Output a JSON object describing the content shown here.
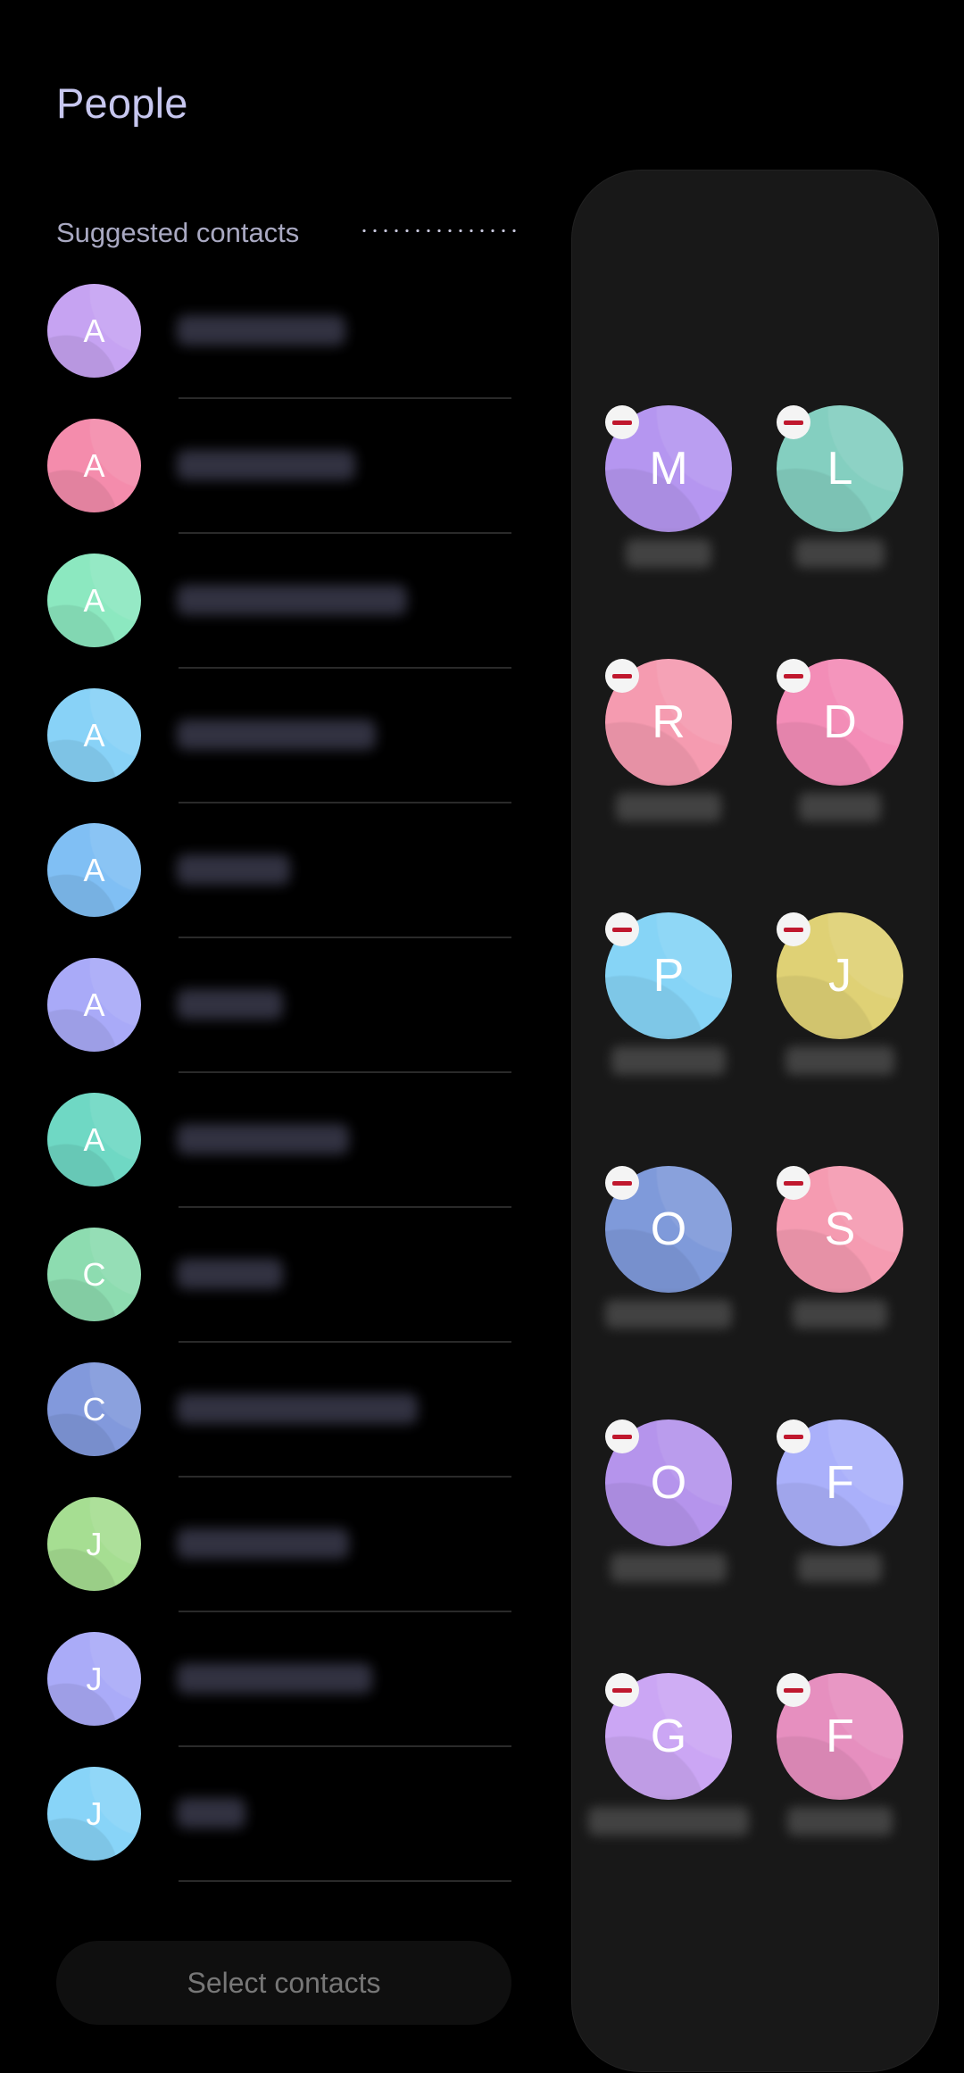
{
  "header": {
    "title": "People"
  },
  "suggested": {
    "section_label": "Suggested contacts",
    "contacts": [
      {
        "initial": "A",
        "color": "#c6a3f2",
        "name": "[blurred]",
        "blur_width": 0.49
      },
      {
        "initial": "A",
        "color": "#f48cac",
        "name": "[blurred]",
        "blur_width": 0.52
      },
      {
        "initial": "A",
        "color": "#8ce8c0",
        "name": "[blurred]",
        "blur_width": 0.67
      },
      {
        "initial": "A",
        "color": "#88d2f7",
        "name": "[blurred]",
        "blur_width": 0.58
      },
      {
        "initial": "A",
        "color": "#80bff4",
        "name": "[blurred]",
        "blur_width": 0.33
      },
      {
        "initial": "A",
        "color": "#a9aaf8",
        "name": "[blurred]",
        "blur_width": 0.31
      },
      {
        "initial": "A",
        "color": "#6fd8c4",
        "name": "[blurred]",
        "blur_width": 0.5
      },
      {
        "initial": "C",
        "color": "#8ddcb0",
        "name": "[blurred]",
        "blur_width": 0.31
      },
      {
        "initial": "C",
        "color": "#8299dc",
        "name": "[blurred]",
        "blur_width": 0.7
      },
      {
        "initial": "J",
        "color": "#a6de92",
        "name": "[blurred]",
        "blur_width": 0.5
      },
      {
        "initial": "J",
        "color": "#aaabf8",
        "name": "[blurred]",
        "blur_width": 0.57
      },
      {
        "initial": "J",
        "color": "#88d4f8",
        "name": "[blurred]",
        "blur_width": 0.2
      }
    ]
  },
  "select_button": {
    "label": "Select contacts"
  },
  "favorites": {
    "remove_icon": "minus-circle-icon",
    "accent_remove_color": "#c0182e",
    "items": [
      {
        "initial": "M",
        "color": "#b596f0",
        "label": "[blurred]"
      },
      {
        "initial": "L",
        "color": "#84cfc0",
        "label": "[blurred]"
      },
      {
        "initial": "R",
        "color": "#f59bb0",
        "label": "[blurred]"
      },
      {
        "initial": "D",
        "color": "#f38db7",
        "label": "[blurred]"
      },
      {
        "initial": "P",
        "color": "#86d4f6",
        "label": "[blurred]"
      },
      {
        "initial": "J",
        "color": "#dfd175",
        "label": "[blurred]"
      },
      {
        "initial": "O",
        "color": "#7f9ada",
        "label": "[blurred]"
      },
      {
        "initial": "S",
        "color": "#f59bb1",
        "label": "[blurred]"
      },
      {
        "initial": "O",
        "color": "#b594ec",
        "label": "[blurred]"
      },
      {
        "initial": "F",
        "color": "#aab0fa",
        "label": "[blurred]"
      },
      {
        "initial": "G",
        "color": "#cba6f4",
        "label": "[blurred]"
      },
      {
        "initial": "F",
        "color": "#e68fbf",
        "label": "[blurred]"
      }
    ]
  }
}
